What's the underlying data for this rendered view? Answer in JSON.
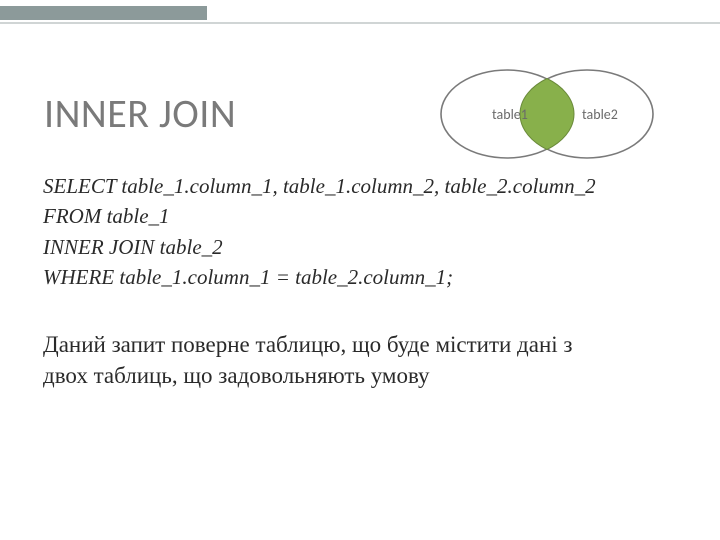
{
  "header": {
    "title": "INNER JOIN"
  },
  "venn": {
    "left_label": "table1",
    "right_label": "table2"
  },
  "sql": {
    "line1": "SELECT table_1.column_1, table_1.column_2, table_2.column_2",
    "line2": "FROM table_1",
    "line3": "INNER JOIN table_2",
    "line4": "WHERE table_1.column_1 = table_2.column_1;"
  },
  "description": {
    "text": "Даний запит поверне таблицю, що буде містити дані з двох таблиць, що задовольняють умову"
  }
}
